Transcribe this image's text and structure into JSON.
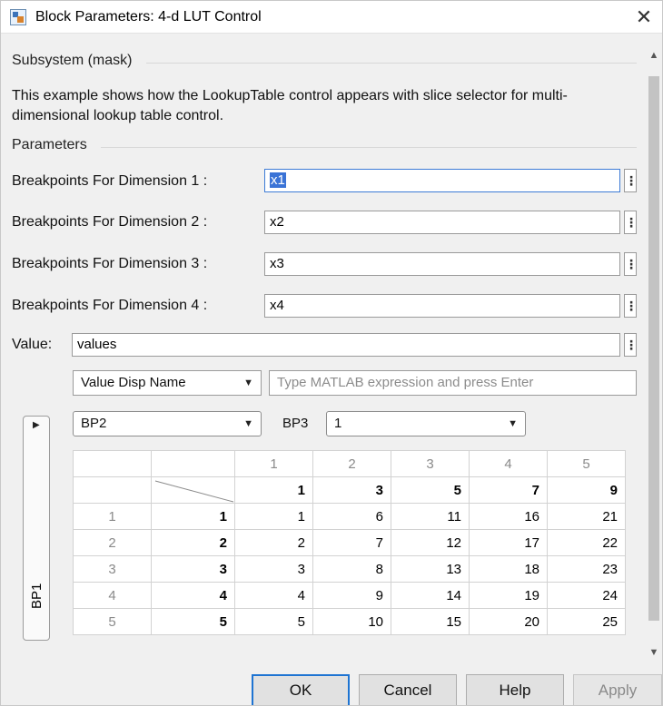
{
  "window": {
    "title": "Block Parameters: 4-d LUT Control",
    "close_glyph": "✕"
  },
  "mask": {
    "heading": "Subsystem (mask)",
    "description": "This example shows how the LookupTable control appears with slice selector for multi-dimensional lookup table control."
  },
  "parameters": {
    "heading": "Parameters",
    "rows": [
      {
        "label": "Breakpoints For Dimension 1 :",
        "value": "x1"
      },
      {
        "label": "Breakpoints For Dimension 2 :",
        "value": "x2"
      },
      {
        "label": "Breakpoints For Dimension 3 :",
        "value": "x3"
      },
      {
        "label": "Breakpoints For Dimension 4 :",
        "value": "x4"
      }
    ],
    "value_label": "Value:",
    "value_value": "values",
    "menu_glyph": "⋮"
  },
  "lut": {
    "disp_name_select": "Value Disp Name",
    "expression_placeholder": "Type MATLAB expression and press Enter",
    "bp2_select": "BP2",
    "bp3_label": "BP3",
    "bp3_select": "1",
    "vertical_tab_label": "BP1",
    "col_index": [
      "1",
      "2",
      "3",
      "4",
      "5"
    ],
    "col_breakpoints": [
      "1",
      "3",
      "5",
      "7",
      "9"
    ],
    "rows": [
      {
        "index": "1",
        "bp": "1",
        "values": [
          "1",
          "6",
          "11",
          "16",
          "21"
        ]
      },
      {
        "index": "2",
        "bp": "2",
        "values": [
          "2",
          "7",
          "12",
          "17",
          "22"
        ]
      },
      {
        "index": "3",
        "bp": "3",
        "values": [
          "3",
          "8",
          "13",
          "18",
          "23"
        ]
      },
      {
        "index": "4",
        "bp": "4",
        "values": [
          "4",
          "9",
          "14",
          "19",
          "24"
        ]
      },
      {
        "index": "5",
        "bp": "5",
        "values": [
          "5",
          "10",
          "15",
          "20",
          "25"
        ]
      }
    ]
  },
  "buttons": {
    "ok": "OK",
    "cancel": "Cancel",
    "help": "Help",
    "apply": "Apply"
  },
  "colors": {
    "accent": "#1e74d2",
    "selection": "#3a73d6",
    "focus_border": "#3d7bd6"
  }
}
